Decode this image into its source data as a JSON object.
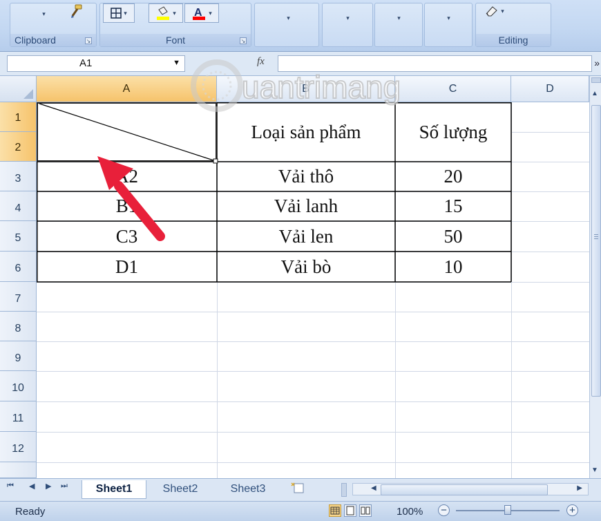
{
  "ribbon": {
    "groups": {
      "clipboard": "Clipboard",
      "font": "Font",
      "editing": "Editing"
    },
    "icons": {
      "format_painter": "format-painter-icon",
      "borders": "borders-icon",
      "fill_color": "fill-color-icon",
      "font_color": "font-color-icon",
      "clear": "eraser-icon"
    },
    "colors": {
      "fill": "#ffff00",
      "font_color": "#ff0000"
    }
  },
  "formula_bar": {
    "name_box": "A1",
    "fx_label": "fx",
    "value": ""
  },
  "columns": [
    "A",
    "B",
    "C",
    "D"
  ],
  "rows": [
    "1",
    "2",
    "3",
    "4",
    "5",
    "6",
    "7",
    "8",
    "9",
    "10",
    "11",
    "12"
  ],
  "active_cell": "A1",
  "table": {
    "header": {
      "b": "Loại sản phẩm",
      "c": "Số lượng"
    },
    "rows": [
      {
        "a": "A2",
        "b": "Vải thô",
        "c": "20"
      },
      {
        "a": "B1",
        "b": "Vải lanh",
        "c": "15"
      },
      {
        "a": "C3",
        "b": "Vải len",
        "c": "50"
      },
      {
        "a": "D1",
        "b": "Vải bò",
        "c": "10"
      }
    ]
  },
  "watermark": "uantrimang",
  "sheets": [
    "Sheet1",
    "Sheet2",
    "Sheet3"
  ],
  "active_sheet": "Sheet1",
  "status": {
    "text": "Ready",
    "zoom": "100%"
  },
  "annotation": {
    "arrow_color": "#e8203a"
  }
}
